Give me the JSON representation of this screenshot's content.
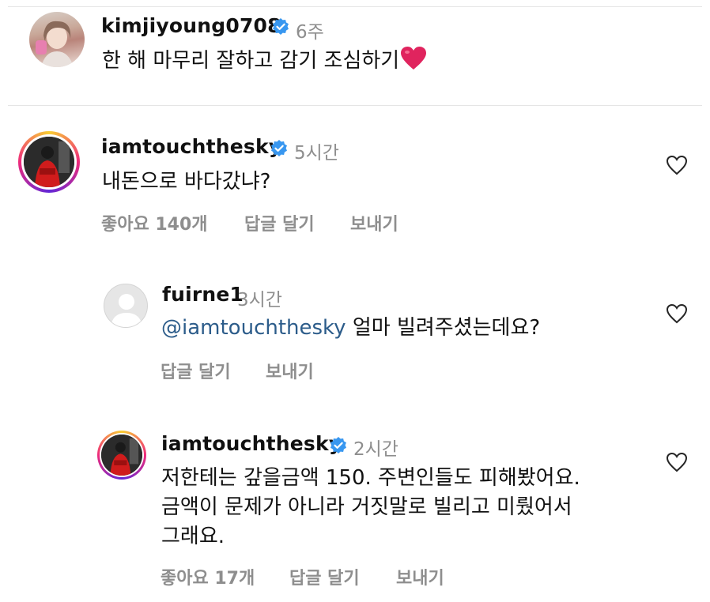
{
  "comments": [
    {
      "username": "kimjiyoung0708",
      "time": "6주",
      "text": "한 해 마무리 잘하고 감기 조심하기",
      "emoji": "❤️"
    },
    {
      "username": "iamtouchthesky",
      "time": "5시간",
      "text": "내돈으로 바다갔냐?",
      "likes": "좋아요 140개",
      "reply": "답글 달기",
      "send": "보내기"
    },
    {
      "username": "fuirne1",
      "time": "3시간",
      "mention": "@iamtouchthesky",
      "text": " 얼마 빌려주셨는데요?",
      "reply": "답글 달기",
      "send": "보내기"
    },
    {
      "username": "iamtouchthesky",
      "time": "2시간",
      "lines": [
        "저한테는 갚을금액 150. 주변인들도 피해봤어요.",
        "금액이 문제가 아니라 거짓말로 빌리고 미뤘어서",
        "그래요."
      ],
      "likes": "좋아요 17개",
      "reply": "답글 달기",
      "send": "보내기"
    }
  ],
  "colors": {
    "verified": "#3897f0",
    "mention": "#2c5c8a",
    "muted": "#8e8e8e",
    "heart_emoji": "#e0245e"
  },
  "icons": [
    "verified-badge-icon",
    "heart-outline-icon",
    "red-heart-emoji"
  ]
}
